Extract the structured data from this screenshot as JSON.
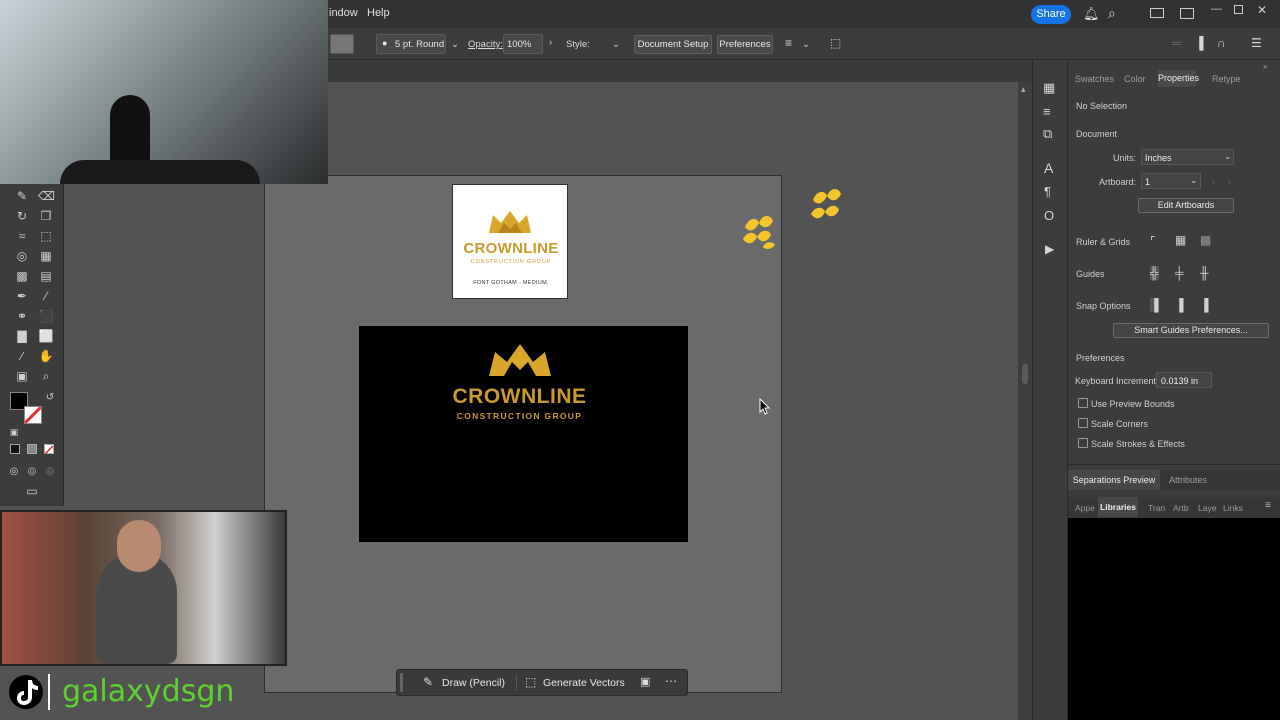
{
  "menubar": {
    "items": [
      "indow",
      "Help"
    ],
    "share_label": "Share"
  },
  "controlbar": {
    "stroke_profile": "5 pt. Round",
    "opacity_label": "Opacity:",
    "opacity_value": "100%",
    "style_label": "Style:",
    "document_setup_label": "Document Setup",
    "preferences_label": "Preferences"
  },
  "canvas": {
    "white_logo": {
      "brand": "CROWNLINE",
      "tagline": "CONSTRUCTION GROUP",
      "note": "FONT GOTHAM - MEDIUM,"
    },
    "black_logo": {
      "brand": "CROWNLINE",
      "tagline": "CONSTRUCTION GROUP"
    }
  },
  "contextual_bar": {
    "draw_label": "Draw (Pencil)",
    "generate_label": "Generate Vectors"
  },
  "panel": {
    "tabs": [
      "Swatches",
      "Color",
      "Properties",
      "Retype"
    ],
    "active_tab": "Properties",
    "selection": "No Selection",
    "document_heading": "Document",
    "units_label": "Units:",
    "units_value": "Inches",
    "artboard_label": "Artboard:",
    "artboard_value": "1",
    "edit_artboards_label": "Edit Artboards",
    "ruler_grids_label": "Ruler & Grids",
    "guides_label": "Guides",
    "snap_options_label": "Snap Options",
    "smart_guides_label": "Smart Guides Preferences...",
    "preferences_heading": "Preferences",
    "keyboard_increment_label": "Keyboard Increment:",
    "keyboard_increment_value": "0.0139 in",
    "checkboxes": [
      "Use Preview Bounds",
      "Scale Corners",
      "Scale Strokes & Effects"
    ],
    "lower_tabs": [
      "Separations Preview",
      "Attributes"
    ],
    "library_tabs": [
      "Appe",
      "Libraries",
      "Tran",
      "Artb",
      "Laye",
      "Links"
    ]
  },
  "overlay": {
    "handle": "galaxydsgn"
  },
  "colors": {
    "accent": "#1473e6",
    "gold": "#d9a62a",
    "handle_green": "#5cd32c"
  }
}
